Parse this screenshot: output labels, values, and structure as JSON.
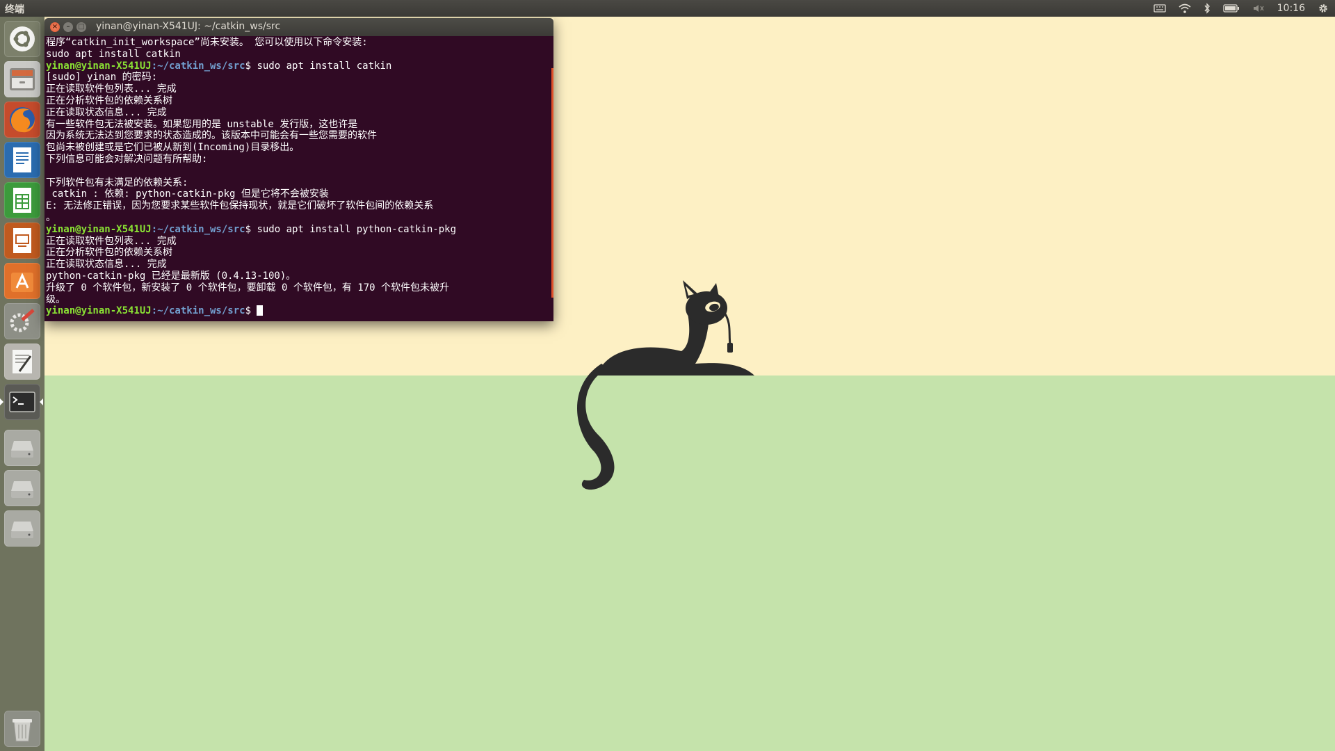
{
  "panel": {
    "app_name": "终端",
    "clock": "10:16",
    "indicators": [
      "keyboard-icon",
      "wifi-icon",
      "bluetooth-icon",
      "battery-icon",
      "volume-muted-icon",
      "gear-icon"
    ]
  },
  "launcher": {
    "items": [
      {
        "name": "dash-home",
        "icon": "ubuntu-logo-icon"
      },
      {
        "name": "files",
        "icon": "file-cabinet-icon"
      },
      {
        "name": "firefox",
        "icon": "firefox-icon"
      },
      {
        "name": "writer",
        "icon": "libreoffice-writer-icon"
      },
      {
        "name": "calc",
        "icon": "libreoffice-calc-icon"
      },
      {
        "name": "impress",
        "icon": "libreoffice-impress-icon"
      },
      {
        "name": "software-center",
        "icon": "software-center-icon"
      },
      {
        "name": "system-settings",
        "icon": "settings-wrench-icon"
      },
      {
        "name": "text-editor",
        "icon": "text-editor-icon"
      },
      {
        "name": "terminal",
        "icon": "terminal-icon"
      },
      {
        "name": "drive-1",
        "icon": "hard-drive-icon"
      },
      {
        "name": "drive-2",
        "icon": "hard-drive-icon"
      },
      {
        "name": "drive-3",
        "icon": "hard-drive-icon"
      },
      {
        "name": "trash",
        "icon": "trash-icon"
      }
    ]
  },
  "terminal": {
    "title": "yinan@yinan-X541UJ: ~/catkin_ws/src",
    "prompt_user": "yinan@yinan-X541UJ",
    "prompt_path": ":~/catkin_ws/src",
    "prompt_sym": "$ ",
    "lines": {
      "l1": "程序“catkin_init_workspace”尚未安装。 您可以使用以下命令安装:",
      "l2": "sudo apt install catkin",
      "cmd1": "sudo apt install catkin",
      "l4": "[sudo] yinan 的密码:",
      "l5": "正在读取软件包列表... 完成",
      "l6": "正在分析软件包的依赖关系树",
      "l7": "正在读取状态信息... 完成",
      "l8": "有一些软件包无法被安装。如果您用的是 unstable 发行版，这也许是",
      "l9": "因为系统无法达到您要求的状态造成的。该版本中可能会有一些您需要的软件",
      "l10": "包尚未被创建或是它们已被从新到(Incoming)目录移出。",
      "l11": "下列信息可能会对解决问题有所帮助:",
      "l12": "",
      "l13": "下列软件包有未满足的依赖关系:",
      "l14": " catkin : 依赖: python-catkin-pkg 但是它将不会被安装",
      "l15": "E: 无法修正错误，因为您要求某些软件包保持现状，就是它们破坏了软件包间的依赖关系",
      "l16": "。",
      "cmd2": "sudo apt install python-catkin-pkg",
      "l18": "正在读取软件包列表... 完成",
      "l19": "正在分析软件包的依赖关系树",
      "l20": "正在读取状态信息... 完成",
      "l21": "python-catkin-pkg 已经是最新版 (0.4.13-100)。",
      "l22": "升级了 0 个软件包，新安装了 0 个软件包，要卸载 0 个软件包，有 170 个软件包未被升",
      "l23": "级。"
    }
  },
  "colors": {
    "terminal_bg": "#300a24",
    "prompt_user": "#8ae234",
    "prompt_path": "#729fcf",
    "desktop_sky": "#fdf0c4",
    "desktop_ground": "#c5e3ab",
    "launcher_bg": "#6f735e"
  }
}
